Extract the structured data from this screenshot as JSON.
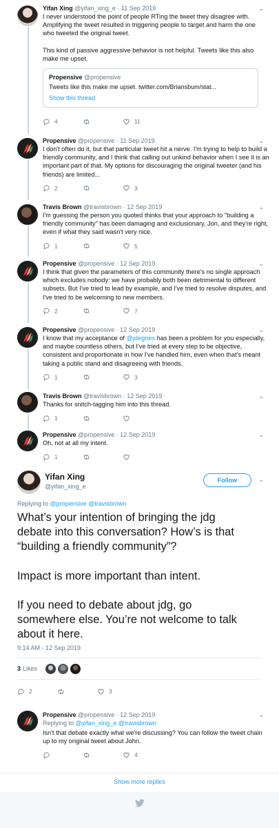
{
  "tweets": [
    {
      "name": "Yifan Xing",
      "handle": "@yifan_xing_e",
      "date": "11 Sep 2019",
      "lines": [
        "I never understood the point of people RTing the tweet they disagree with.",
        "Amplifying the tweet resulted in triggering people to target and harm the one",
        "who tweeted the original tweet."
      ],
      "lines2": [
        "This kind of passive aggressive behavior is not helpful. Tweets like this also",
        "make me upset."
      ],
      "quote": {
        "name": "Propensive",
        "handle": "@propensive",
        "text": "Tweets like this make me upset. twitter.com/Briansbum/stat...",
        "show": "Show this thread"
      },
      "reply_count": "4",
      "retweet_count": "",
      "like_count": "11"
    },
    {
      "name": "Propensive",
      "handle": "@propensive",
      "date": "11 Sep 2019",
      "lines": [
        "I don't often do it, but that particular tweet hit a nerve. I'm trying to help to build a",
        "friendly community, and I think that calling out unkind behavior when I see it is an",
        "important part of that. My options for discouraging the original tweeter (and his",
        "friends) are limited..."
      ],
      "reply_count": "2",
      "retweet_count": "",
      "like_count": "3"
    },
    {
      "name": "Travis Brown",
      "handle": "@travisbrown",
      "date": "12 Sep 2019",
      "lines": [
        "I'm guessing the person you quoted thinks that your approach to \"building a",
        "friendly community\" has been damaging and exclusionary, Jon, and they're right,",
        "even if what they said wasn't very nice."
      ],
      "reply_count": "1",
      "retweet_count": "",
      "like_count": "5"
    },
    {
      "name": "Propensive",
      "handle": "@propensive",
      "date": "12 Sep 2019",
      "lines": [
        "I think that given the parameters of this community there's no single approach",
        "which excludes nobody: we have probably both been detrimental to different",
        "subsets. But I've tried to lead by example, and I've tried to resolve disputes, and",
        "I've tried to be welcoming to new members."
      ],
      "reply_count": "2",
      "retweet_count": "",
      "like_count": "7"
    },
    {
      "name": "Propensive",
      "handle": "@propensive",
      "date": "12 Sep 2019",
      "line1_pre": "I know that my acceptance of ",
      "line1_mention": "@jdegoes",
      "line1_post": " has been a problem for you especially,",
      "lines": [
        "and maybe countless others, but I've tried at every step to be objective,",
        "consistent and proportionate in how I've handled him, even when that's meant",
        "taking a public stand and disagreeing with friends."
      ],
      "reply_count": "1",
      "retweet_count": "",
      "like_count": "3"
    },
    {
      "name": "Travis Brown",
      "handle": "@travisbrown",
      "date": "12 Sep 2019",
      "lines": [
        "Thanks for snitch-tagging him into this thread."
      ],
      "reply_count": "1",
      "retweet_count": "",
      "like_count": ""
    },
    {
      "name": "Propensive",
      "handle": "@propensive",
      "date": "12 Sep 2019",
      "lines": [
        "Oh, not at all my intent."
      ],
      "reply_count": "1",
      "retweet_count": "",
      "like_count": ""
    }
  ],
  "focus": {
    "name": "Yifan Xing",
    "handle": "@yifan_xing_e",
    "follow_label": "Follow",
    "replying_to_label": "Replying to",
    "replying_to_1": "@propensive",
    "replying_to_2": "@travisbrown",
    "text": [
      "What’s your intention of bringing the jdg",
      "debate into this conversation? How’s is that",
      "“building a friendly community”?",
      "Impact is more important than intent.",
      "If you need to debate about jdg, go",
      "somewhere else. You’re not welcome to talk",
      "about it here."
    ],
    "timestamp": "9:14 AM - 12 Sep 2019",
    "likes_count": "3",
    "likes_label": "Likes",
    "reply_count": "2",
    "retweet_count": "",
    "like_count": "3"
  },
  "last_reply": {
    "name": "Propensive",
    "handle": "@propensive",
    "date": "12 Sep 2019",
    "replying_to_label": "Replying to",
    "replying_to_1": "@yifan_xing_e",
    "replying_to_2": "@travisbrown",
    "lines": [
      "Isn't that debate exactly what we're discussing? You can follow the tweet chain",
      "up to my original tweet about John."
    ],
    "reply_count": "",
    "retweet_count": "",
    "like_count": "4"
  },
  "more_replies_label": "Show more replies",
  "icons": [
    "reply-icon",
    "retweet-icon",
    "like-icon",
    "chevron-down-icon",
    "twitter-bird-icon"
  ],
  "colors": {
    "accent": "#1da1f2",
    "muted": "#657786",
    "divider": "#e6ecf0"
  }
}
